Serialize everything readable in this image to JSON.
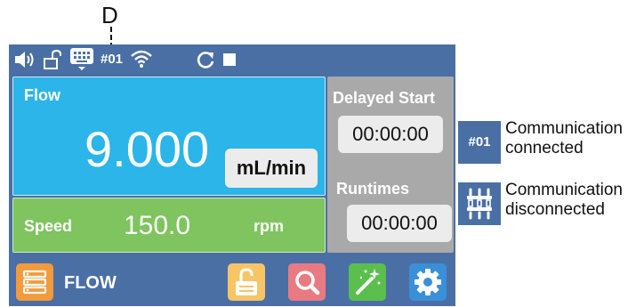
{
  "callout": {
    "label": "D"
  },
  "status_bar": {
    "comm_id": "#01",
    "icons": [
      "speaker-icon",
      "unlock-icon",
      "keyboard-icon",
      "wifi-icon",
      "refresh-icon",
      "stop-icon"
    ]
  },
  "flow": {
    "label": "Flow",
    "value": "9.000",
    "unit": "mL/min"
  },
  "speed": {
    "label": "Speed",
    "value": "150.0",
    "unit": "rpm"
  },
  "delayed_start": {
    "label": "Delayed Start",
    "time": "00:00:00"
  },
  "runtimes": {
    "label": "Runtimes",
    "time": "00:00:00"
  },
  "bottom_bar": {
    "mode_label": "FLOW",
    "buttons": [
      "menu-icon",
      "unlock-icon",
      "search-icon",
      "magic-wand-icon",
      "gear-icon"
    ]
  },
  "legend": {
    "connected": {
      "badge": "#01",
      "line1": "Communication",
      "line2": "connected"
    },
    "disconnected": {
      "line1": "Communication",
      "line2": "disconnected"
    }
  },
  "colors": {
    "frame": "#4a6fa5",
    "flow_panel": "#2bb5e8",
    "speed_panel": "#7fc45e",
    "time_panel": "#a9a9aa",
    "menu_button": "#f39a3a",
    "unlock_button": "#f7c566",
    "search_button": "#e97a82",
    "wand_button": "#5bbf4e",
    "settings_button": "#3a8fd8"
  }
}
